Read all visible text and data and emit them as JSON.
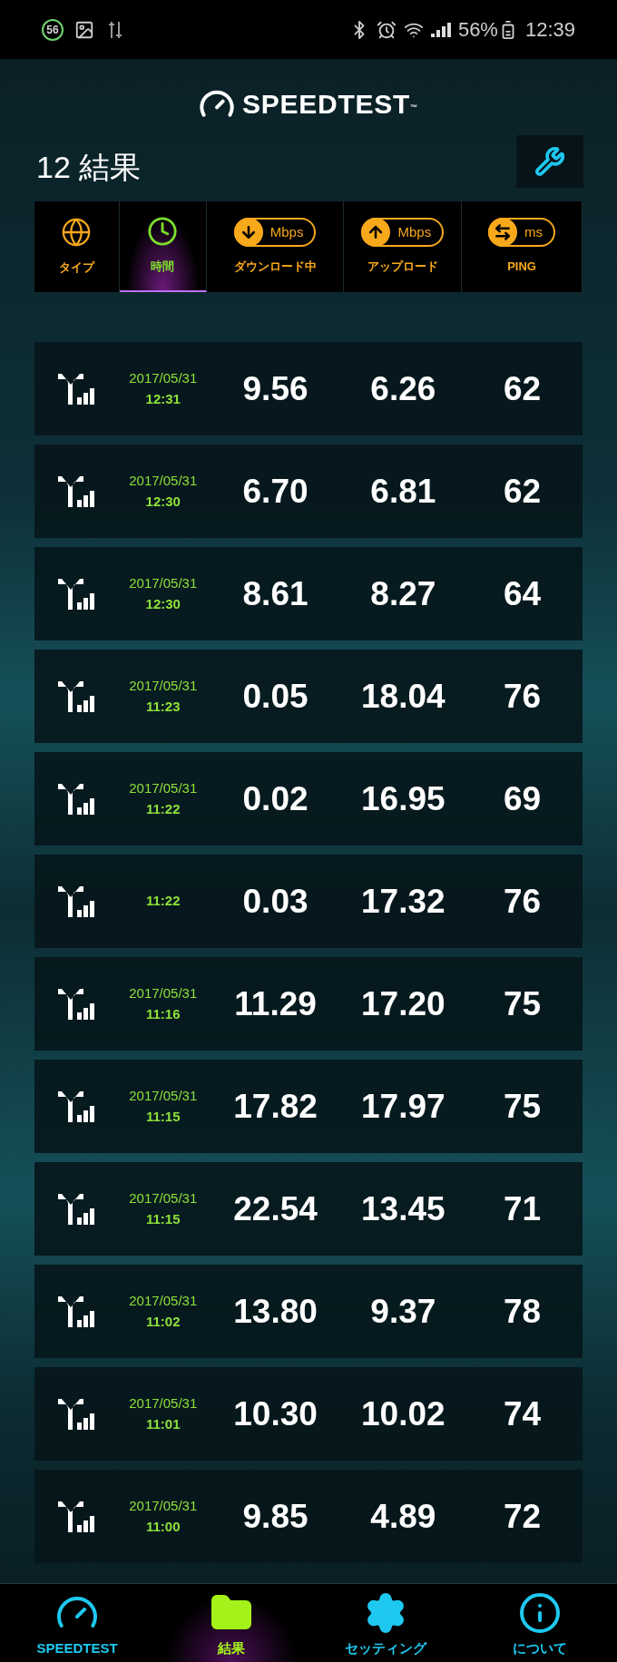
{
  "status_bar": {
    "badge": "56",
    "battery": "56%",
    "time": "12:39"
  },
  "app": {
    "title": "SPEEDTEST",
    "trademark": "™"
  },
  "results": {
    "title": "12 結果"
  },
  "columns": [
    {
      "kind": "type",
      "label": "タイプ",
      "selected": false
    },
    {
      "kind": "time",
      "label": "時間",
      "selected": true
    },
    {
      "kind": "download",
      "label": "ダウンロード中",
      "unit": "Mbps",
      "selected": false
    },
    {
      "kind": "upload",
      "label": "アップロード",
      "unit": "Mbps",
      "selected": false
    },
    {
      "kind": "ping",
      "label": "PING",
      "unit": "ms",
      "selected": false
    }
  ],
  "rows": [
    {
      "date": "2017/05/31",
      "time": "12:31",
      "download": "9.56",
      "upload": "6.26",
      "ping": "62"
    },
    {
      "date": "2017/05/31",
      "time": "12:30",
      "download": "6.70",
      "upload": "6.81",
      "ping": "62"
    },
    {
      "date": "2017/05/31",
      "time": "12:30",
      "download": "8.61",
      "upload": "8.27",
      "ping": "64"
    },
    {
      "date": "2017/05/31",
      "time": "11:23",
      "download": "0.05",
      "upload": "18.04",
      "ping": "76"
    },
    {
      "date": "2017/05/31",
      "time": "11:22",
      "download": "0.02",
      "upload": "16.95",
      "ping": "69"
    },
    {
      "time": "11:22",
      "download": "0.03",
      "upload": "17.32",
      "ping": "76"
    },
    {
      "date": "2017/05/31",
      "time": "11:16",
      "download": "11.29",
      "upload": "17.20",
      "ping": "75"
    },
    {
      "date": "2017/05/31",
      "time": "11:15",
      "download": "17.82",
      "upload": "17.97",
      "ping": "75"
    },
    {
      "date": "2017/05/31",
      "time": "11:15",
      "download": "22.54",
      "upload": "13.45",
      "ping": "71"
    },
    {
      "date": "2017/05/31",
      "time": "11:02",
      "download": "13.80",
      "upload": "9.37",
      "ping": "78"
    },
    {
      "date": "2017/05/31",
      "time": "11:01",
      "download": "10.30",
      "upload": "10.02",
      "ping": "74"
    },
    {
      "date": "2017/05/31",
      "time": "11:00",
      "download": "9.85",
      "upload": "4.89",
      "ping": "72"
    }
  ],
  "nav": [
    {
      "kind": "speedtest",
      "label": "SPEEDTEST",
      "selected": false
    },
    {
      "kind": "results",
      "label": "結果",
      "selected": true
    },
    {
      "kind": "settings",
      "label": "セッティング",
      "selected": false
    },
    {
      "kind": "about",
      "label": "について",
      "selected": false
    }
  ]
}
